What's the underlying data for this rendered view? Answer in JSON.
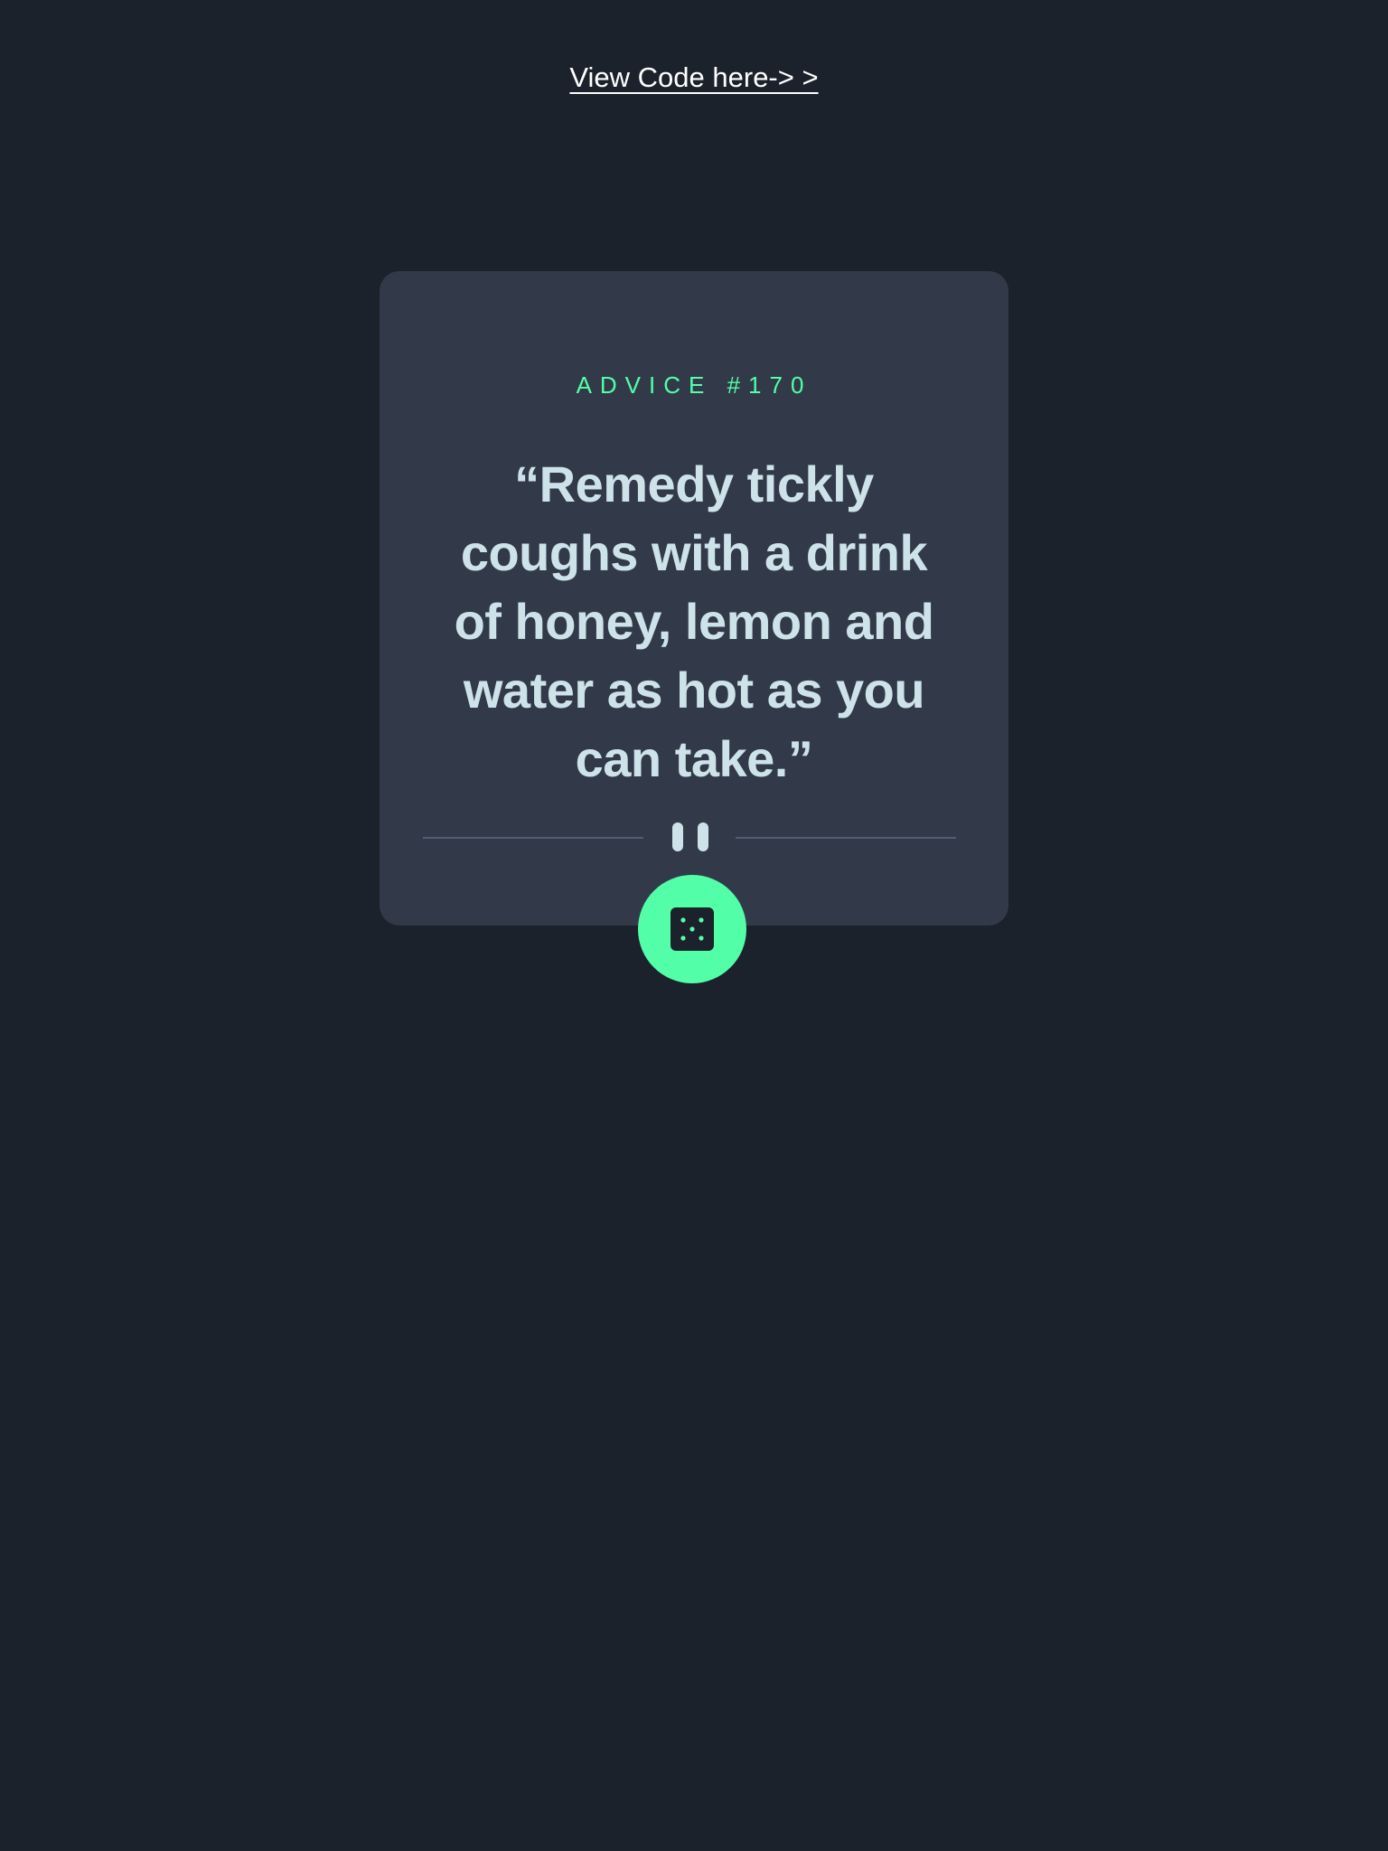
{
  "header": {
    "link_text": "View Code here-> >"
  },
  "card": {
    "advice_label": "ADVICE #170",
    "quote": "“Remedy tickly coughs with a drink of honey, lemon and water as hot as you can take.”"
  },
  "icons": {
    "divider": "pause-icon",
    "button": "dice-icon"
  },
  "colors": {
    "background": "#1c222c",
    "card": "#323a49",
    "accent": "#52ffa8",
    "quote_text": "#cee3e9",
    "divider": "#4f5d74"
  }
}
